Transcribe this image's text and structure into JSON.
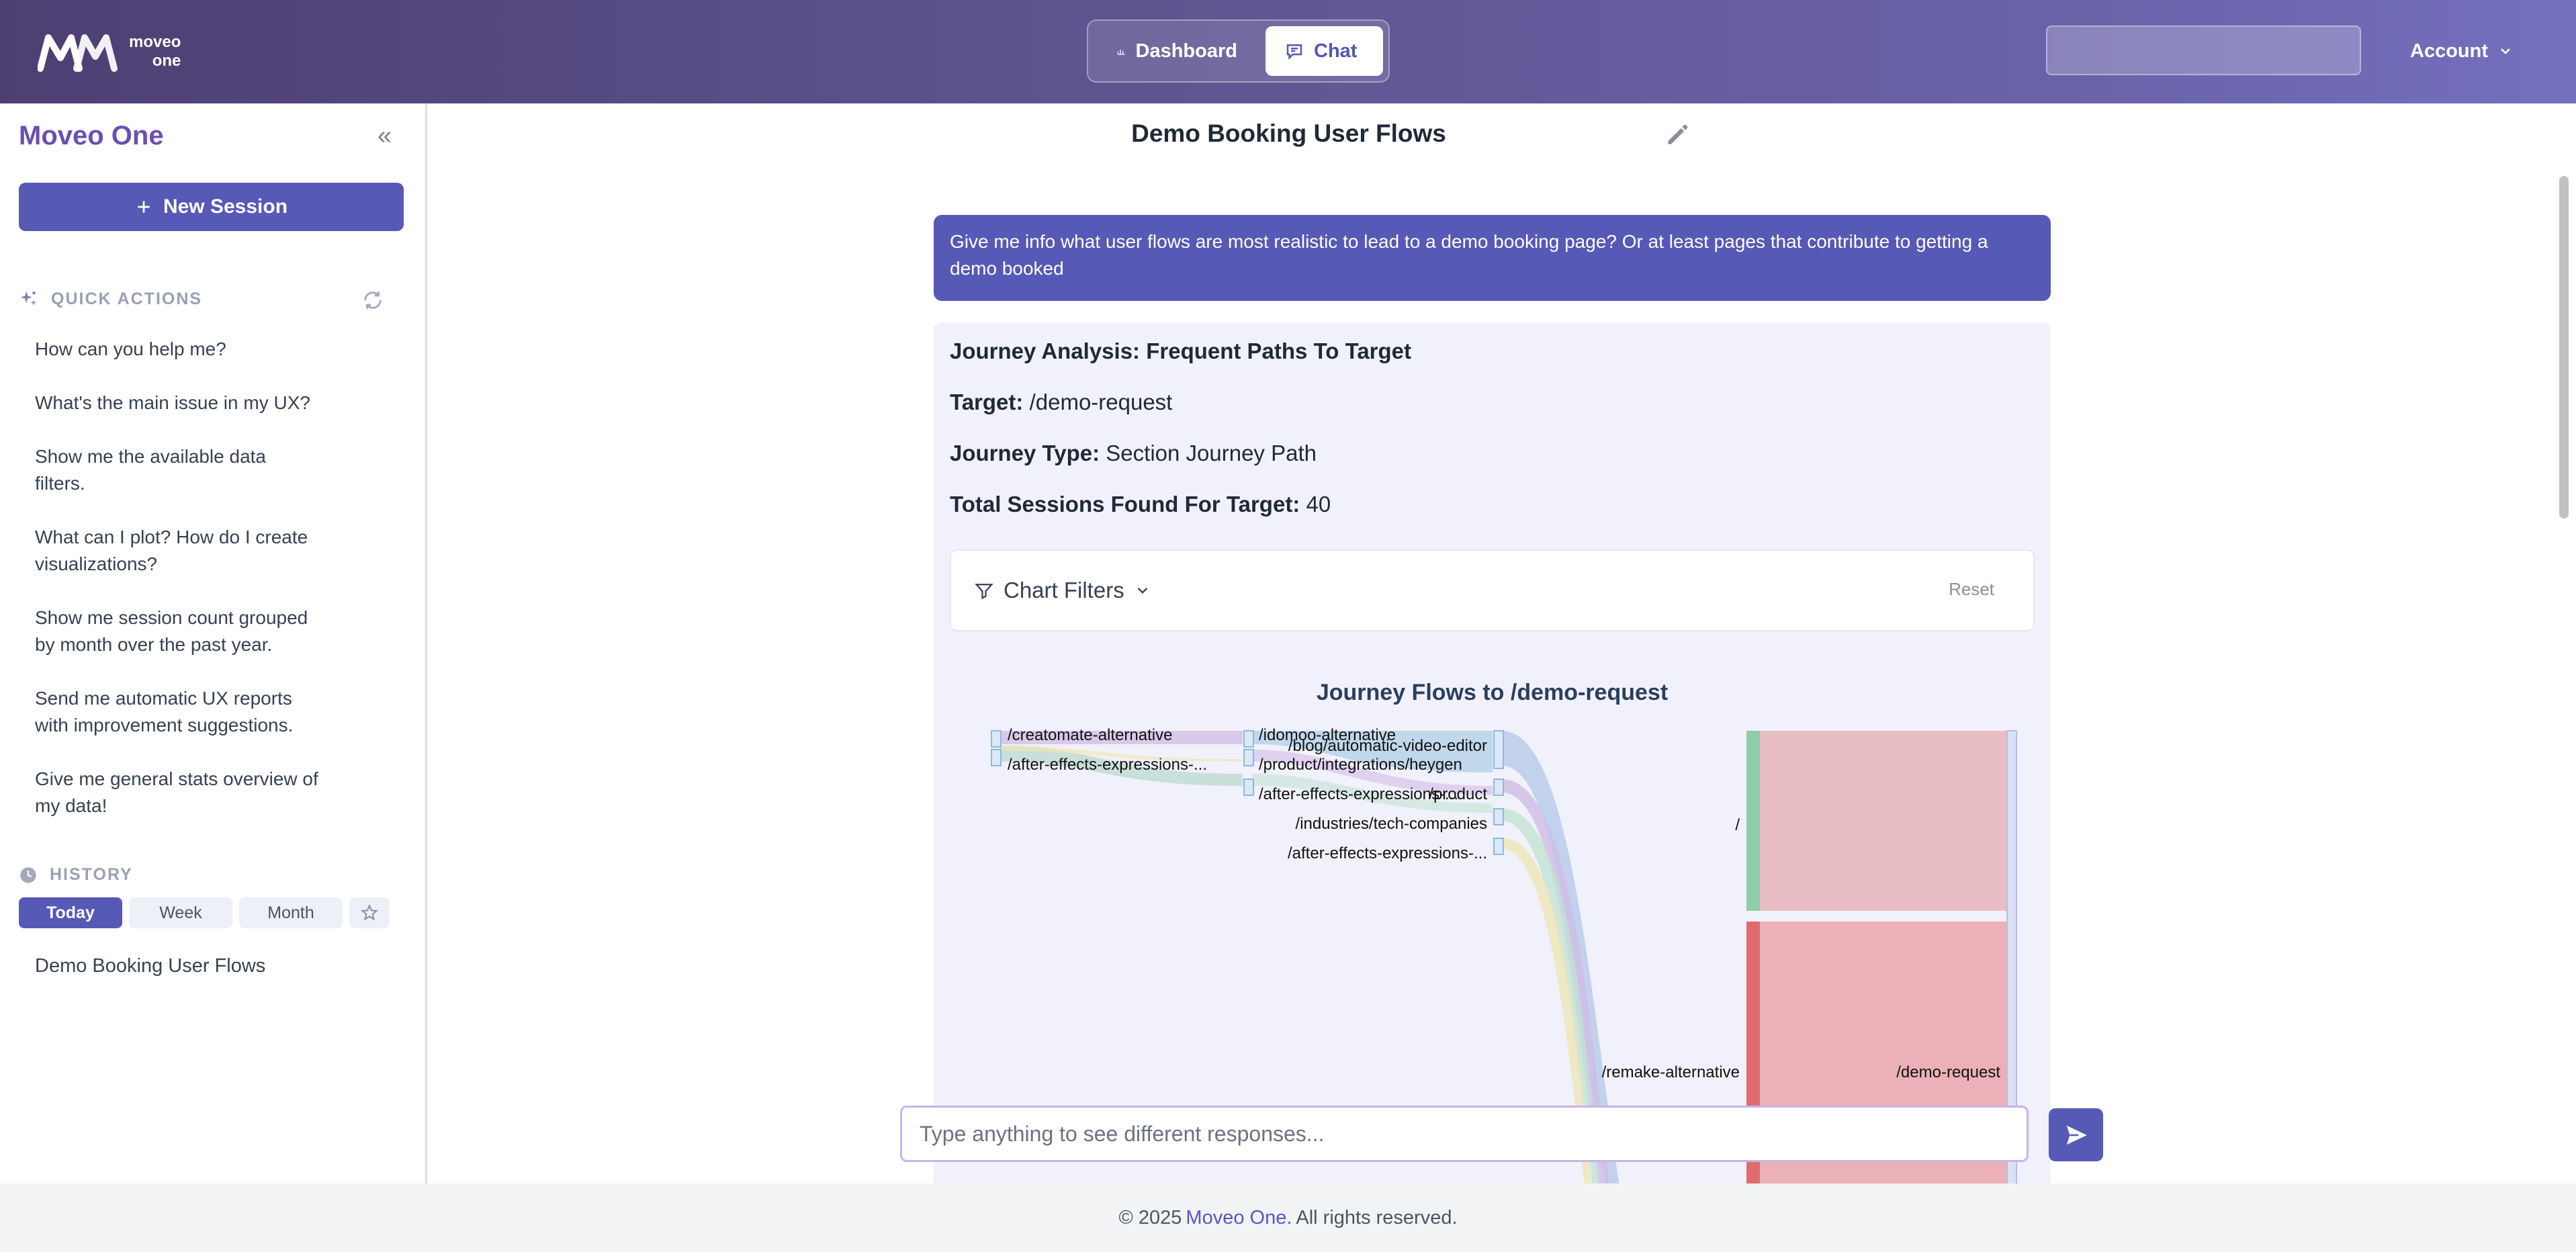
{
  "header": {
    "logo_line1": "moveo",
    "logo_line2": "one",
    "nav": [
      {
        "label": "Dashboard",
        "icon": "bar-chart-icon"
      },
      {
        "label": "Chat",
        "icon": "chat-icon"
      }
    ],
    "account_label": "Account"
  },
  "sidebar": {
    "title": "Moveo One",
    "new_session_label": "New Session",
    "quick_actions_title": "QUICK ACTIONS",
    "quick_actions": [
      "How can you help me?",
      "What's the main issue in my UX?",
      "Show me the available data filters.",
      "What can I plot? How do I create visualizations?",
      "Show me session count grouped by month over the past year.",
      "Send me automatic UX reports with improvement suggestions.",
      "Give me general stats overview of my data!"
    ],
    "history_title": "HISTORY",
    "history_tabs": [
      "Today",
      "Week",
      "Month"
    ],
    "history_items": [
      "Demo Booking User Flows"
    ]
  },
  "main": {
    "session_title": "Demo Booking User Flows",
    "user_message": "Give me info what user flows are most realistic to lead to a demo booking page? Or at least pages that contribute to getting a demo booked",
    "answer": {
      "heading": "Journey Analysis: Frequent Paths To Target",
      "target_label": "Target:",
      "target_value": "/demo-request",
      "journey_type_label": "Journey Type:",
      "journey_type_value": "Section Journey Path",
      "total_label": "Total Sessions Found For Target:",
      "total_value": "40",
      "filters_label": "Chart Filters",
      "reset_label": "Reset"
    },
    "composer_placeholder": "Type anything to see different responses..."
  },
  "chart_data": {
    "type": "sankey",
    "title": "Journey Flows to /demo-request",
    "nodes": [
      {
        "id": "n1",
        "label": "/creatomate-alternative",
        "column": 0
      },
      {
        "id": "n2",
        "label": "/after-effects-expressions-...",
        "column": 0
      },
      {
        "id": "n3",
        "label": "/idomoo-alternative",
        "column": 1
      },
      {
        "id": "n4",
        "label": "/product/integrations/heygen",
        "column": 1
      },
      {
        "id": "n5",
        "label": "/after-effects-expressions-...",
        "column": 1
      },
      {
        "id": "n6",
        "label": "/blog/automatic-video-editor",
        "column": 2
      },
      {
        "id": "n7",
        "label": "/product",
        "column": 2
      },
      {
        "id": "n8",
        "label": "/industries/tech-companies",
        "column": 2
      },
      {
        "id": "n9",
        "label": "/after-effects-expressions-...",
        "column": 2
      },
      {
        "id": "n10",
        "label": "/remake-alternative",
        "column": 2
      },
      {
        "id": "n11",
        "label": "/",
        "column": 3
      },
      {
        "id": "n12",
        "label": "/demo-request",
        "column": 4
      }
    ]
  },
  "footer": {
    "copyright": "© 2025",
    "brand": "Moveo One.",
    "rights": "All rights reserved."
  }
}
